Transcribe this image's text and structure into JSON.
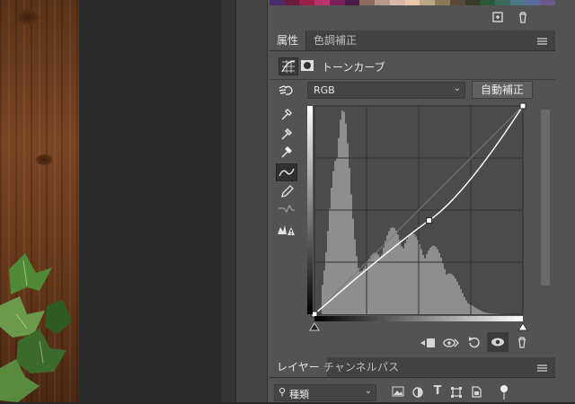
{
  "panel": {
    "tabs": [
      "属性",
      "色調補正"
    ],
    "adjustment_title": "トーンカーブ",
    "channel": "RGB",
    "auto_button": "自動補正"
  },
  "layers_panel": {
    "tabs": [
      "レイヤー",
      "チャンネル",
      "パス"
    ],
    "filter_label": "種類"
  },
  "colors": {
    "panel_bg": "#535353",
    "graph_bg": "#4b4b4b",
    "histogram": "#8e8e8e",
    "curve": "#ffffff"
  },
  "swatches": [
    "#4b2b6b",
    "#6b1b3b",
    "#9a1f4b",
    "#b8336a",
    "#7a1f5a",
    "#4a1a4a",
    "#8a6a5a",
    "#b89a8a",
    "#d8b8a8",
    "#e8c8a8",
    "#b8a888",
    "#8a7a5a",
    "#5a4a3a",
    "#3a3a2a",
    "#2a5a3a",
    "#3a6a5a",
    "#4a7a8a",
    "#5a6a9a",
    "#6a5a8a"
  ],
  "curve": {
    "points": [
      [
        0,
        0
      ],
      [
        0.55,
        0.45
      ],
      [
        1,
        1
      ]
    ]
  },
  "icons": {
    "targeted_adjust": "hand-icon",
    "eyedropper_black": "eyedropper-icon",
    "eyedropper_gray": "eyedropper-icon",
    "eyedropper_white": "eyedropper-icon",
    "curve_tool": "curve-icon",
    "pencil_tool": "pencil-icon",
    "smooth_tool": "smooth-icon",
    "clipping_warning": "warning-icon"
  }
}
